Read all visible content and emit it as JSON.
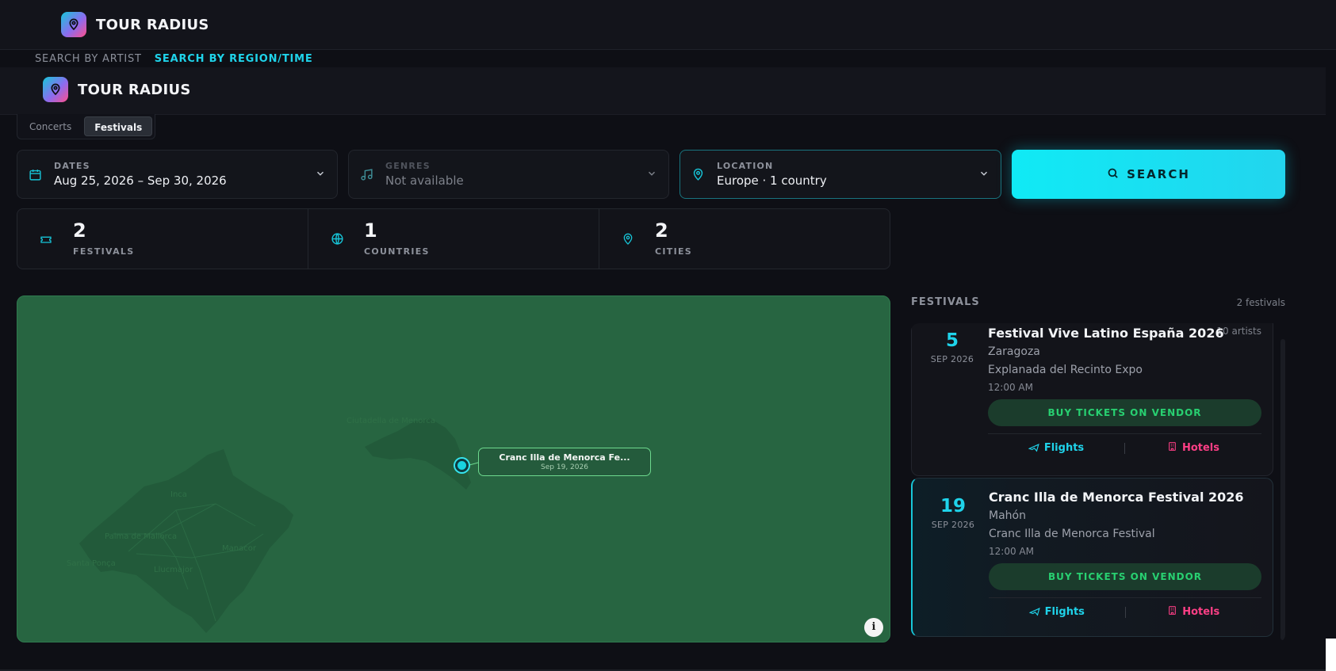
{
  "app": {
    "brand": "TOUR RADIUS",
    "logo_icon": "map-pin-icon",
    "colors": {
      "accent": "#1fd3ea",
      "buy_green": "#28d071",
      "hotel_pink": "#ff3f86",
      "map_water": "#276541"
    }
  },
  "modes": {
    "artist": "SEARCH BY ARTIST",
    "region": "SEARCH BY REGION/TIME"
  },
  "tabs": [
    {
      "label": "Concerts"
    },
    {
      "label": "Festivals"
    }
  ],
  "filters": {
    "dates": {
      "label": "DATES",
      "value": "Aug 25, 2026 – Sep 30, 2026",
      "icon": "calendar-icon"
    },
    "genres": {
      "label": "GENRES",
      "value": "Not available",
      "icon": "music-note-icon"
    },
    "location": {
      "label": "LOCATION",
      "value": "Europe · 1 country",
      "icon": "map-pin-icon"
    }
  },
  "search_button": {
    "label": "SEARCH",
    "icon": "search-icon"
  },
  "stats": [
    {
      "value": "2",
      "label": "FESTIVALS",
      "icon": "ticket-icon"
    },
    {
      "value": "1",
      "label": "COUNTRIES",
      "icon": "globe-icon"
    },
    {
      "value": "2",
      "label": "CITIES",
      "icon": "map-pin-icon"
    }
  ],
  "map": {
    "callout_title": "Cranc Illa de Menorca Fe...",
    "callout_date": "Sep 19, 2026",
    "labels": [
      "Ciutadella de Menorca",
      "Inca",
      "Palma de Mallorca",
      "Santa Ponça",
      "Llucmajor",
      "Manacor"
    ],
    "info_glyph": "i"
  },
  "list": {
    "title": "FESTIVALS",
    "count": "2 festivals",
    "items": [
      {
        "day": "5",
        "month_year": "SEP 2026",
        "title": "Festival Vive Latino España 2026",
        "artists": "10 artists",
        "city": "Zaragoza",
        "venue": "Explanada del Recinto Expo",
        "time": "12:00 AM",
        "buy_label": "BUY TICKETS ON VENDOR",
        "flights_label": "Flights",
        "hotels_label": "Hotels"
      },
      {
        "day": "19",
        "month_year": "SEP 2026",
        "title": "Cranc Illa de Menorca Festival 2026",
        "city": "Mahón",
        "venue": "Cranc Illa de Menorca Festival",
        "time": "12:00 AM",
        "buy_label": "BUY TICKETS ON VENDOR",
        "flights_label": "Flights",
        "hotels_label": "Hotels"
      }
    ]
  }
}
